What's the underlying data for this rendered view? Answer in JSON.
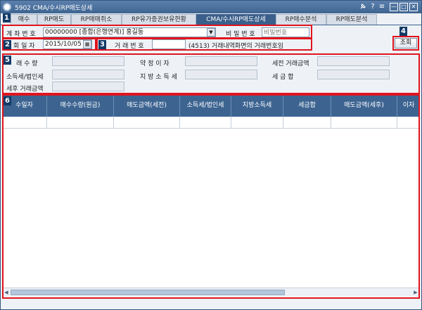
{
  "window": {
    "title": "5902 CMA/수시RP매도상세",
    "icons": [
      "pin-icon",
      "help-icon",
      "menu-icon",
      "minimize-icon",
      "maximize-icon",
      "close-icon"
    ],
    "help_glyph": "?",
    "menu_glyph": "≡",
    "minimize_glyph": "—",
    "maximize_glyph": "□",
    "close_glyph": "✕"
  },
  "tabs": [
    {
      "label": "매수"
    },
    {
      "label": "RP매도"
    },
    {
      "label": "RP매매취소"
    },
    {
      "label": "RP유가증권보유현황"
    },
    {
      "label": "CMA/수시RP매도상세",
      "active": true
    },
    {
      "label": "RP매수분석"
    },
    {
      "label": "RP매도분석"
    }
  ],
  "markers": [
    "1",
    "2",
    "3",
    "4",
    "5",
    "6"
  ],
  "form": {
    "account_label": "계 좌 번 호",
    "account_value": "00000000 [종합(은행연계)] 홍길동",
    "password_label": "비 밀 번 호",
    "password_placeholder": "비밀번호",
    "inquiry_date_label": "회 일 자",
    "inquiry_date_value": "2015/10/05",
    "trade_no_label": "거 래 번 호",
    "trade_no_value": "",
    "trade_no_note": "(4513) 거래내역화면의 거래번호임",
    "query_button": "조회"
  },
  "summary": {
    "sell_qty_label": "래 수 량",
    "interest_label": "약 정 이 자",
    "pretax_amount_label": "세전 거래금액",
    "income_tax_label": "소득세/법인세",
    "local_tax_label": "지 방 소 득 세",
    "tax_label": "세 금 합",
    "aftertax_amount_label": "세후 거래금액"
  },
  "grid": {
    "columns": [
      "수일자",
      "매수수량(원금)",
      "매도금액(세전)",
      "소득세/법인세",
      "지방소득세",
      "세금합",
      "매도금액(세후)",
      "이자"
    ]
  },
  "colors": {
    "accent": "#3d6491",
    "highlight": "#e0141e"
  }
}
